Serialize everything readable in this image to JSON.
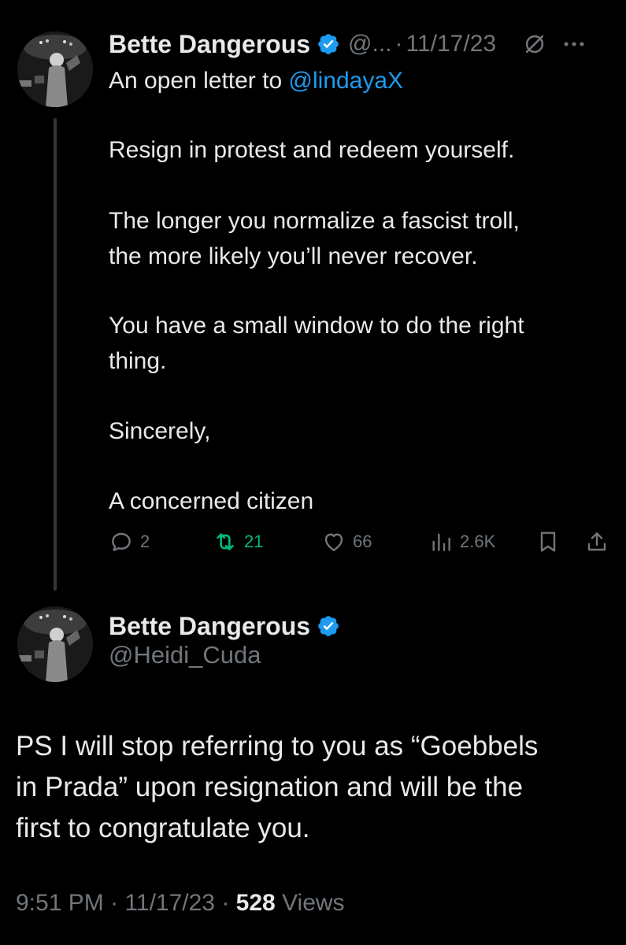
{
  "original_tweet": {
    "display_name": "Bette Dangerous",
    "handle": "@...",
    "separator": "·",
    "date": "11/17/23",
    "text_line1_prefix": "An open letter to ",
    "mention": "@lindayaX",
    "paragraph1": "Resign in protest and redeem yourself.",
    "paragraph2_line1": "The longer you normalize a fascist troll,",
    "paragraph2_line2": "the more likely you’ll never recover.",
    "paragraph3_line1": "You have a small window to do the right",
    "paragraph3_line2": "thing.",
    "paragraph4": "Sincerely,",
    "paragraph5": "A concerned citizen",
    "stats": {
      "replies": "2",
      "reposts": "21",
      "likes": "66",
      "views": "2.6K"
    },
    "icons": {
      "verified": "verified-badge-icon",
      "mute": "mute-icon",
      "more": "more-icon",
      "reply": "reply-icon",
      "repost": "repost-icon",
      "like": "heart-icon",
      "views": "views-icon",
      "bookmark": "bookmark-icon",
      "share": "share-icon"
    }
  },
  "reply_tweet": {
    "display_name": "Bette Dangerous",
    "handle": "@Heidi_Cuda",
    "text_line1": "PS I will stop referring to you as “Goebbels",
    "text_line2": "in Prada” upon resignation and will be the",
    "text_line3": "first to congratulate you.",
    "time": "9:51 PM",
    "separator": "·",
    "date": "11/17/23",
    "views_count": "528",
    "views_label": "Views"
  },
  "colors": {
    "background": "#000000",
    "text_primary": "#e7e9ea",
    "text_secondary": "#71767b",
    "accent_blue": "#1d9bf0",
    "repost_green": "#00ba7c",
    "thread_line": "#333639"
  }
}
